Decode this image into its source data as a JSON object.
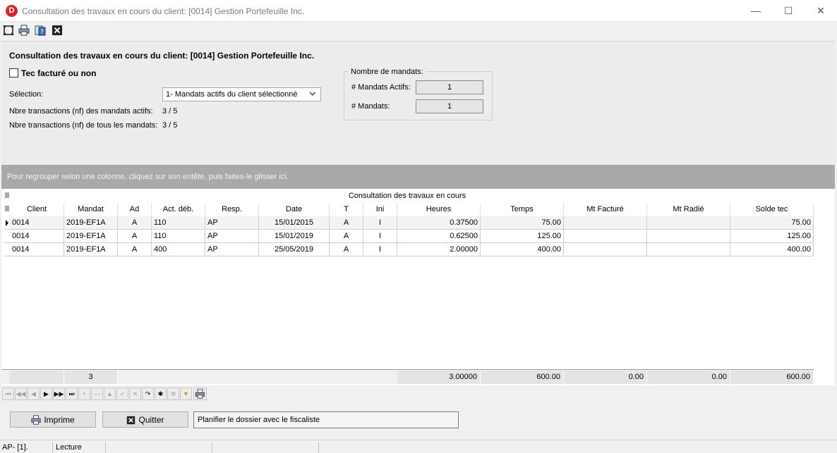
{
  "window": {
    "title": "Consultation des travaux en cours du client:  [0014]  Gestion Portefeuille Inc.",
    "minimize_glyph": "—",
    "maximize_glyph": "☐",
    "close_glyph": "✕"
  },
  "toolbar": {
    "icons": [
      "fit-window-icon",
      "printer-icon",
      "help-icon",
      "close-box-icon"
    ]
  },
  "header": {
    "heading": "Consultation des travaux en cours du client:  [0014]  Gestion Portefeuille Inc.",
    "checkbox_label": "Tec facturé ou non",
    "checkbox_checked": false,
    "selection_label": "Sélection:",
    "selection_value": "1- Mandats actifs du client sélectionné",
    "nf_active_label": "Nbre transactions (nf) des mandats actifs:",
    "nf_active_value": "3 / 5",
    "nf_all_label": "Nbre transactions (nf) de tous les mandats:",
    "nf_all_value": "3 / 5"
  },
  "mandats_group": {
    "title": "Nombre de mandats:",
    "active_label": "# Mandats Actifs:",
    "active_value": "1",
    "total_label": "# Mandats:",
    "total_value": "1"
  },
  "group_hint": "Pour regrouper selon une colonne, cliquez sur son entête, puis faites-le glisser ici.",
  "grid": {
    "caption": "Consultation des travaux en cours",
    "columns": [
      "Client",
      "Mandat",
      "Ad",
      "Act. déb.",
      "Resp.",
      "Date",
      "T",
      "Ini",
      "Heures",
      "Temps",
      "Mt Facturé",
      "Mt Radié",
      "Solde tec"
    ],
    "rows": [
      [
        "0014",
        "2019-EF1A",
        "A",
        "110",
        "AP",
        "15/01/2015",
        "A",
        "I",
        "0.37500",
        "75.00",
        "",
        "",
        "75.00"
      ],
      [
        "0014",
        "2019-EF1A",
        "A",
        "110",
        "AP",
        "15/01/2019",
        "A",
        "I",
        "0.62500",
        "125.00",
        "",
        "",
        "125.00"
      ],
      [
        "0014",
        "2019-EF1A",
        "A",
        "400",
        "AP",
        "25/05/2019",
        "A",
        "I",
        "2.00000",
        "400.00",
        "",
        "",
        "400.00"
      ]
    ],
    "footer": {
      "count": "3",
      "heures": "3.00000",
      "temps": "600.00",
      "mt_facture": "0.00",
      "mt_radie": "0.00",
      "solde_tec": "600.00"
    }
  },
  "navigator": {
    "first": "⏮",
    "prev_page": "◀◀",
    "prev": "◀",
    "next": "▶",
    "next_page": "▶▶",
    "last": "⏭",
    "insert": "+",
    "delete": "—",
    "edit": "▲",
    "post": "✓",
    "cancel": "✕",
    "refresh": "↷",
    "bookmark": "✱",
    "goto_bookmark": "✲",
    "filter": "▼"
  },
  "actions": {
    "print_label": "Imprime",
    "quit_label": "Quitter",
    "note_value": "Planifier le dossier avec le fiscaliste"
  },
  "statusbar": {
    "position": "AP- [1].",
    "mode": "Lecture"
  }
}
